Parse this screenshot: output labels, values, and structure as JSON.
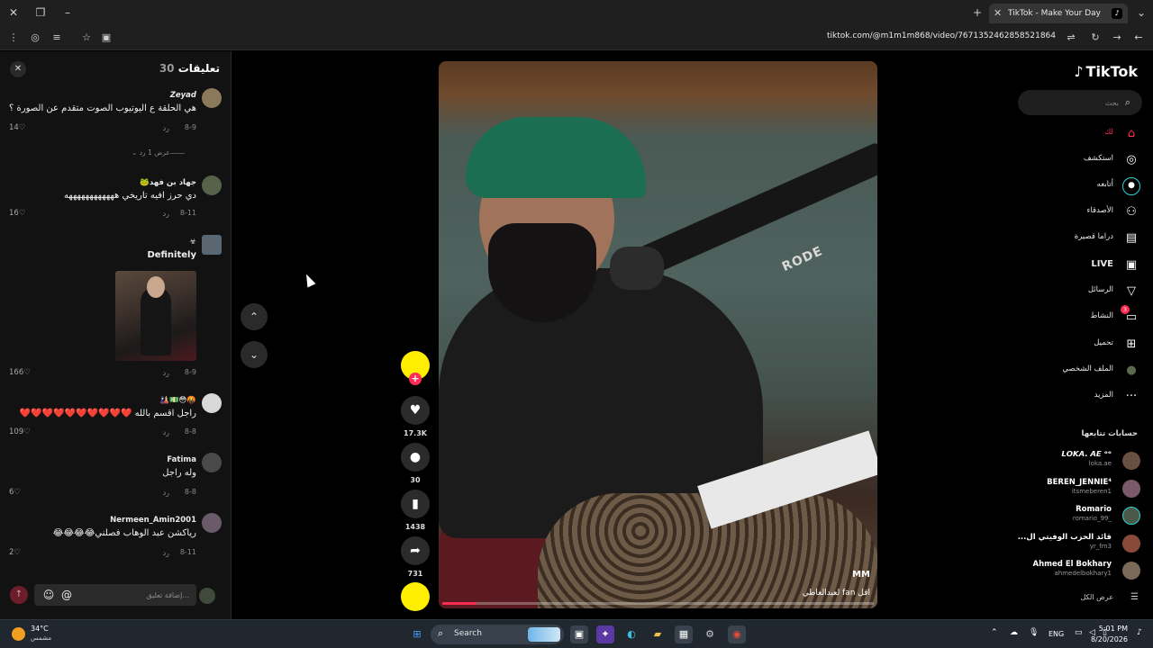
{
  "browser": {
    "tab_title": "TikTok - Make Your Day",
    "url": "tiktok.com/@m1m1m868/video/7671352462858521864"
  },
  "comments": {
    "title": "تعليقات",
    "count": "30",
    "items": [
      {
        "user": "Zeyad",
        "text": "هي الحلقة ع اليوتيوب الصوت متقدم عن الصورة ؟",
        "date": "8-9",
        "reply": "رد",
        "likes": "14"
      },
      {
        "user": "جهاد بن فهد🐸",
        "text": "دي حرز افيه تاريخي ههههههههههههه",
        "date": "8-11",
        "reply": "رد",
        "likes": "16"
      },
      {
        "user": "☣",
        "text": "Definitely",
        "date": "8-9",
        "reply": "رد",
        "likes": "166"
      },
      {
        "user": "🤬😳💵🎎",
        "text": "راجل اقسم بالله ❤️❤️❤️❤️❤️❤️❤️❤️❤️❤️",
        "date": "8-8",
        "reply": "رد",
        "likes": "109"
      },
      {
        "user": "Fatima",
        "text": "وله راجل",
        "date": "8-8",
        "reply": "رد",
        "likes": "6"
      },
      {
        "user": "Nermeen_Amin2001",
        "text": "رياكشن عبد الوهاب فصلني😂😂😂😂",
        "date": "8-11",
        "reply": "رد",
        "likes": "2"
      }
    ],
    "view_replies": "عرض 1 رد",
    "input_placeholder": "إضافة تعليق...",
    "input_emoji_icon": "☺",
    "input_at_icon": "@"
  },
  "video": {
    "author": "MM",
    "caption": "اقل fan لعبدالعاطي",
    "overlay_text": "RODE",
    "progress": 0.08,
    "accent_color": "#fe2c55"
  },
  "actions": {
    "likes": "17.3K",
    "comments": "30",
    "saves": "1438",
    "shares": "731"
  },
  "sidebar": {
    "brand": "TikTok",
    "search_placeholder": "بحث",
    "nav": [
      {
        "label": "لك",
        "icon": "home-icon",
        "active": true
      },
      {
        "label": "استكشف",
        "icon": "compass-icon"
      },
      {
        "label": "أتابعه",
        "icon": "following-icon"
      },
      {
        "label": "الأصدقاء",
        "icon": "friends-icon"
      },
      {
        "label": "دراما قصيرة",
        "icon": "film-icon"
      },
      {
        "label": "LIVE",
        "icon": "live-icon"
      },
      {
        "label": "الرسائل",
        "icon": "send-icon"
      },
      {
        "label": "النشاط",
        "icon": "inbox-icon",
        "badge": "3"
      },
      {
        "label": "تحميل",
        "icon": "upload-icon"
      },
      {
        "label": "الملف الشخصي",
        "icon": "profile-icon"
      },
      {
        "label": "المزيد",
        "icon": "more-icon"
      }
    ],
    "following_title": "حسابات تتابعها",
    "accounts": [
      {
        "name": "𝙇𝙊𝙆𝘼. 𝘼𝙀 ᵒᵒ",
        "handle": "loka.ae"
      },
      {
        "name": "BEREN_JENNIE⁴",
        "handle": "itsmeberen1"
      },
      {
        "name": "Romario",
        "handle": "romario_99_"
      },
      {
        "name": "قائد الحزب الوفيتي ال...",
        "handle": "yr_fm3"
      },
      {
        "name": "Ahmed El Bokhary",
        "handle": "ahmedelbokhary1"
      }
    ],
    "see_all": "عرض الكل"
  },
  "taskbar": {
    "weather_temp": "34°C",
    "weather_desc": "مشمس",
    "search_label": "Search",
    "lang": "ENG",
    "time": "5:01 PM",
    "date": "8/20/2026"
  }
}
